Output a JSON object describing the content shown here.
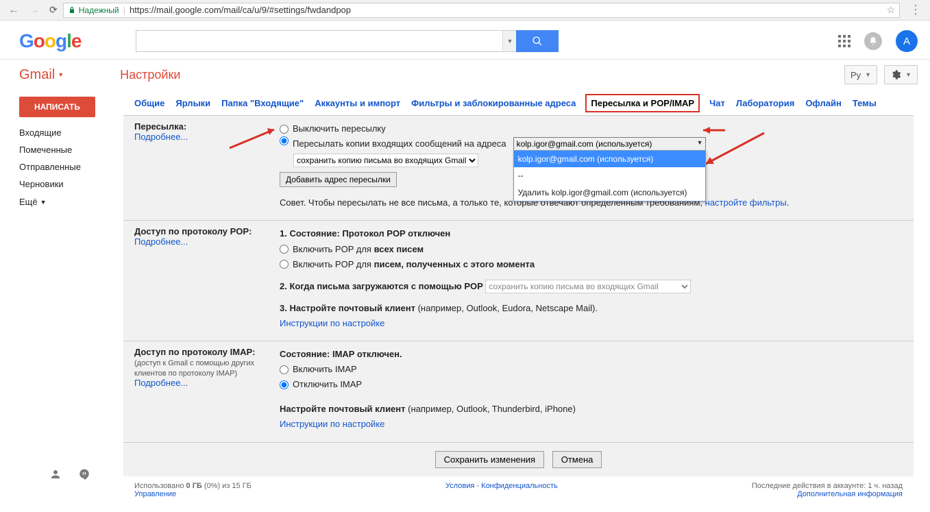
{
  "browser": {
    "secure_label": "Надежный",
    "url": "https://mail.google.com/mail/ca/u/9/#settings/fwdandpop"
  },
  "header": {
    "avatar_letter": "А",
    "lang": "Ру"
  },
  "gmail_label": "Gmail",
  "page_title": "Настройки",
  "compose": "НАПИСАТЬ",
  "sidebar": {
    "items": [
      "Входящие",
      "Помеченные",
      "Отправленные",
      "Черновики"
    ],
    "more": "Ещё"
  },
  "tabs": [
    "Общие",
    "Ярлыки",
    "Папка \"Входящие\"",
    "Аккаунты и импорт",
    "Фильтры и заблокированные адреса",
    "Пересылка и POP/IMAP",
    "Чат",
    "Лаборатория",
    "Офлайн",
    "Темы"
  ],
  "active_tab_index": 5,
  "forwarding": {
    "label": "Пересылка:",
    "more": "Подробнее...",
    "radio_off": "Выключить пересылку",
    "radio_on_prefix": "Пересылать копии входящих сообщений на адреса",
    "address_select": "kolp.igor@gmail.com (используется)",
    "dropdown_opts": [
      "kolp.igor@gmail.com (используется)",
      "--",
      "Удалить kolp.igor@gmail.com (используется)"
    ],
    "keep_copy": "сохранить копию письма во входящих Gmail",
    "add_btn": "Добавить адрес пересылки",
    "tip_prefix": "Совет. Чтобы пересылать не все письма, а только те, которые отвечают определенным требованиям, ",
    "tip_link": "настройте фильтры",
    "tip_suffix": "."
  },
  "pop": {
    "label": "Доступ по протоколу POP:",
    "more": "Подробнее...",
    "status_num": "1. Состояние: ",
    "status_val": "Протокол POP отключен",
    "opt_all_pre": "Включить POP для ",
    "opt_all_b": "всех писем",
    "opt_now_pre": "Включить POP для ",
    "opt_now_b": "писем, полученных с этого момента",
    "step2": "2. Когда письма загружаются с помощью POP",
    "step2_sel": "сохранить копию письма во входящих Gmail",
    "step3_b": "3. Настройте почтовый клиент",
    "step3_rest": " (например, Outlook, Eudora, Netscape Mail).",
    "instr": "Инструкции по настройке"
  },
  "imap": {
    "label": "Доступ по протоколу IMAP:",
    "sub": "(доступ к Gmail с помощью других клиентов по протоколу IMAP)",
    "more": "Подробнее...",
    "status_b": "Состояние: ",
    "status_val": "IMAP отключен.",
    "on": "Включить IMAP",
    "off": "Отключить IMAP",
    "conf_b": "Настройте почтовый клиент",
    "conf_rest": " (например, Outlook, Thunderbird, iPhone)",
    "instr": "Инструкции по настройке"
  },
  "save": "Сохранить изменения",
  "cancel": "Отмена",
  "footer": {
    "storage_pre": "Использовано ",
    "storage_used": "0 ГБ",
    "storage_rest": " (0%) из 15 ГБ",
    "manage": "Управление",
    "terms": "Условия",
    "privacy": "Конфиденциальность",
    "activity": "Последние действия в аккаунте: 1 ч. назад",
    "details": "Дополнительная информация"
  }
}
